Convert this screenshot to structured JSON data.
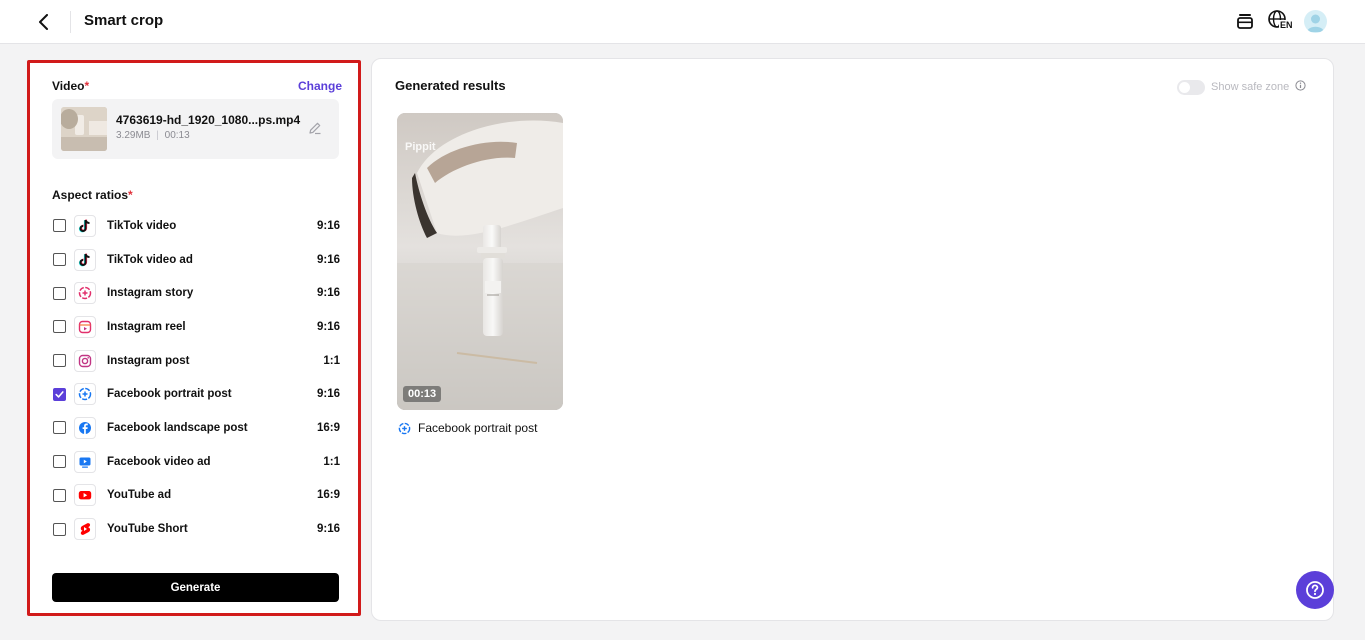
{
  "header": {
    "title": "Smart crop",
    "language_badge": "EN"
  },
  "left_panel": {
    "video_label": "Video",
    "required_mark": "*",
    "change_label": "Change",
    "video_file": {
      "name": "4763619-hd_1920_1080...ps.mp4",
      "size": "3.29MB",
      "separator": "|",
      "duration": "00:13"
    },
    "aspect_label": "Aspect ratios",
    "ratios": [
      {
        "name": "TikTok video",
        "ratio": "9:16",
        "checked": false,
        "icon": "tiktok-icon"
      },
      {
        "name": "TikTok video ad",
        "ratio": "9:16",
        "checked": false,
        "icon": "tiktok-icon"
      },
      {
        "name": "Instagram story",
        "ratio": "9:16",
        "checked": false,
        "icon": "instagram-story-icon"
      },
      {
        "name": "Instagram reel",
        "ratio": "9:16",
        "checked": false,
        "icon": "instagram-reel-icon"
      },
      {
        "name": "Instagram post",
        "ratio": "1:1",
        "checked": false,
        "icon": "instagram-icon"
      },
      {
        "name": "Facebook portrait post",
        "ratio": "9:16",
        "checked": true,
        "icon": "facebook-story-icon"
      },
      {
        "name": "Facebook landscape post",
        "ratio": "16:9",
        "checked": false,
        "icon": "facebook-icon"
      },
      {
        "name": "Facebook video ad",
        "ratio": "1:1",
        "checked": false,
        "icon": "facebook-video-icon"
      },
      {
        "name": "YouTube ad",
        "ratio": "16:9",
        "checked": false,
        "icon": "youtube-icon"
      },
      {
        "name": "YouTube Short",
        "ratio": "9:16",
        "checked": false,
        "icon": "youtube-shorts-icon"
      }
    ],
    "generate_label": "Generate"
  },
  "right_panel": {
    "title": "Generated results",
    "safe_zone_label": "Show safe zone",
    "safe_zone_on": false,
    "results": [
      {
        "watermark": "Pippit",
        "duration": "00:13",
        "caption": "Facebook portrait post",
        "icon": "facebook-story-icon"
      }
    ]
  },
  "colors": {
    "accent": "#5b3fd9",
    "highlight_border": "#d11a1a",
    "required": "#e0303a"
  }
}
